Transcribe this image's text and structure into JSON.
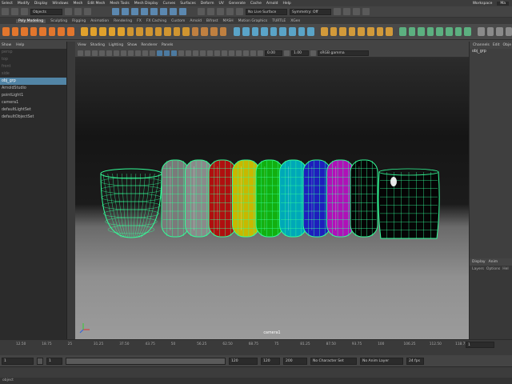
{
  "menubar": {
    "items": [
      "Select",
      "Modify",
      "Display",
      "Windows",
      "Mesh",
      "Edit Mesh",
      "Mesh Tools",
      "Mesh Display",
      "Curves",
      "Surfaces",
      "Deform",
      "UV",
      "Generate",
      "Cache",
      "Arnold",
      "Help"
    ],
    "workspace_label": "Workspace",
    "workspace_value": "Ma"
  },
  "status": {
    "mode": "Objects",
    "live_surface": "No Live Surface",
    "symmetry": "Symmetry: Off"
  },
  "shelf": {
    "tabs": [
      "Poly Modeling",
      "Sculpting",
      "Rigging",
      "Animation",
      "Rendering",
      "FX",
      "FX Caching",
      "Custom",
      "Arnold",
      "Bifrost",
      "MASH",
      "Motion Graphics",
      "TURTLE",
      "XGen"
    ],
    "active_tab": "Poly Modeling",
    "icon_colors": [
      "#e2762d",
      "#e2762d",
      "#e2762d",
      "#e2762d",
      "#e2762d",
      "#e2762d",
      "#e2762d",
      "#e2762d",
      "#e0a12c",
      "#e0a12c",
      "#e0a12c",
      "#e0a12c",
      "#e0a12c",
      "#d09530",
      "#d09530",
      "#d09530",
      "#d09530",
      "#d09530",
      "#d09530",
      "#d09530",
      "#c08040",
      "#c08040",
      "#c08040",
      "#c08040",
      "#5aa4c8",
      "#5aa4c8",
      "#5aa4c8",
      "#5aa4c8",
      "#5aa4c8",
      "#5aa4c8",
      "#5aa4c8",
      "#5aa4c8",
      "#5aa4c8",
      "#d29a3a",
      "#d29a3a",
      "#d29a3a",
      "#d29a3a",
      "#d29a3a",
      "#d29a3a",
      "#d29a3a",
      "#d29a3a",
      "#5cb080",
      "#5cb080",
      "#5cb080",
      "#5cb080",
      "#5cb080",
      "#5cb080",
      "#5cb080",
      "#5cb080",
      "#8a8a8a",
      "#8a8a8a",
      "#8a8a8a",
      "#8a8a8a"
    ]
  },
  "outliner": {
    "menu": [
      "Show",
      "Help"
    ],
    "items": [
      {
        "label": "persp",
        "state": "dim"
      },
      {
        "label": "top",
        "state": "dim"
      },
      {
        "label": "front",
        "state": "dim"
      },
      {
        "label": "side",
        "state": "dim"
      },
      {
        "label": "obj_grp",
        "state": "selected"
      },
      {
        "label": "ArnoldStudio",
        "state": "normal"
      },
      {
        "label": "pointLight1",
        "state": "normal"
      },
      {
        "label": "camera1",
        "state": "normal"
      },
      {
        "label": "defaultLightSet",
        "state": "normal"
      },
      {
        "label": "defaultObjectSet",
        "state": "normal"
      }
    ]
  },
  "viewport": {
    "menu": [
      "View",
      "Shading",
      "Lighting",
      "Show",
      "Renderer",
      "Panels"
    ],
    "exposure": "0.00",
    "gamma": "1.00",
    "colorspace": "sRGB gamma",
    "camera_label": "camera1",
    "objects": [
      {
        "name": "bowl",
        "color": "#00ff90"
      },
      {
        "name": "ring-white-1",
        "color": "#7a7a7a"
      },
      {
        "name": "ring-white-2",
        "color": "#8a8a8a"
      },
      {
        "name": "ring-red",
        "color": "#b00f0f"
      },
      {
        "name": "ring-yellow",
        "color": "#c8b800"
      },
      {
        "name": "ring-green",
        "color": "#12b010"
      },
      {
        "name": "ring-cyan",
        "color": "#00a8b8"
      },
      {
        "name": "ring-blue",
        "color": "#1e1ebd"
      },
      {
        "name": "ring-magenta",
        "color": "#b010b8"
      },
      {
        "name": "ring-black",
        "color": "#050505"
      },
      {
        "name": "barrel-black",
        "color": "#050505"
      }
    ],
    "wire_color": "#33ff99"
  },
  "channelbox": {
    "menu": [
      "Channels",
      "Edit",
      "Obje"
    ],
    "node": "obj_grp"
  },
  "layers": {
    "tabs": [
      "Display",
      "Anim"
    ],
    "menu": [
      "Layers",
      "Options",
      "Hel"
    ]
  },
  "timeline": {
    "ticks": [
      "12.50",
      "18.75",
      "25",
      "31.25",
      "37.50",
      "43.75",
      "50",
      "56.25",
      "62.50",
      "68.75",
      "75",
      "81.25",
      "87.50",
      "93.75",
      "100",
      "106.25",
      "112.50",
      "118.75"
    ],
    "current_frame": "1"
  },
  "range": {
    "start": "1",
    "inner_start": "1",
    "inner_end": "120",
    "end_inner": "120",
    "end": "200",
    "character_set": "No Character Set",
    "anim_layer": "No Anim Layer",
    "fps": "24 fps"
  },
  "helpline": "object"
}
